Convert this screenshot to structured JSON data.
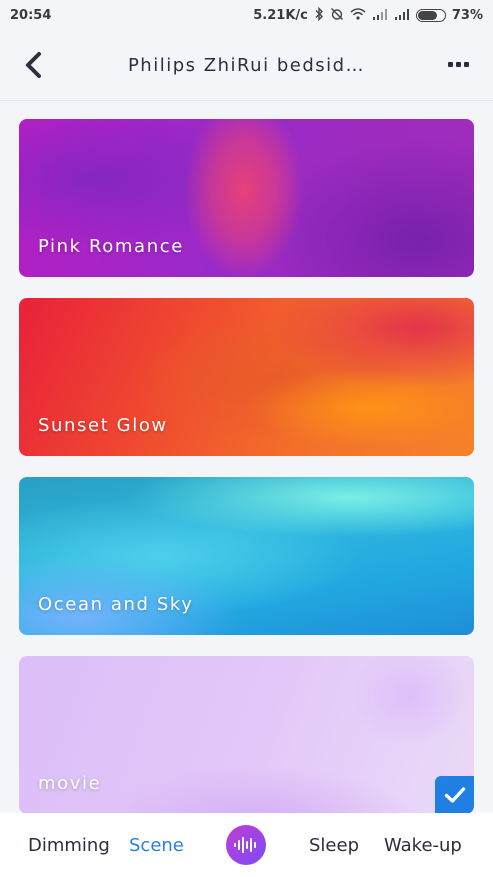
{
  "status_bar": {
    "time": "20:54",
    "network_speed": "5.21K/c",
    "battery_percent": "73%",
    "icons": [
      "bluetooth-icon",
      "alarm-off-icon",
      "wifi-icon",
      "signal-icon",
      "signal-icon",
      "battery-icon"
    ]
  },
  "header": {
    "title": "Philips ZhiRui bedsid…",
    "back_icon": "chevron-left-icon",
    "more_icon": "more-icon"
  },
  "scenes": [
    {
      "label": "Pink Romance",
      "selected": false
    },
    {
      "label": "Sunset Glow",
      "selected": false
    },
    {
      "label": "Ocean and Sky",
      "selected": false
    },
    {
      "label": "movie",
      "selected": true
    }
  ],
  "tabs": {
    "dimming": "Dimming",
    "scene": "Scene",
    "music_icon": "music-wave-icon",
    "sleep": "Sleep",
    "wakeup": "Wake-up",
    "active": "Scene"
  },
  "colors": {
    "accent": "#2a7fe0",
    "check_badge": "#1f7fe3",
    "background": "#f4f5f9"
  }
}
